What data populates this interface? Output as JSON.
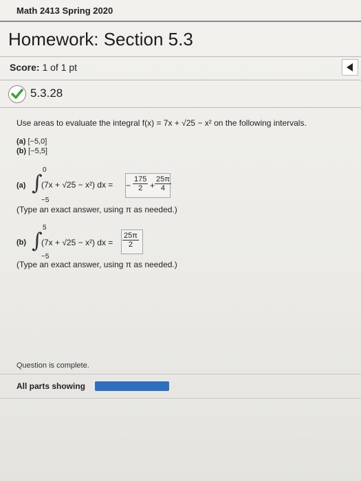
{
  "course_title": "Math 2413 Spring 2020",
  "homework_title": "Homework: Section 5.3",
  "score": {
    "label": "Score:",
    "value": "1 of 1 pt"
  },
  "question_id": "5.3.28",
  "question": {
    "prompt": "Use areas to evaluate the integral f(x) = 7x + √25 − x² on the following intervals.",
    "intervals": [
      {
        "label": "(a)",
        "value": "[−5,0]"
      },
      {
        "label": "(b)",
        "value": "[−5,5]"
      }
    ]
  },
  "parts": [
    {
      "label": "(a)",
      "upper": "0",
      "lower": "−5",
      "integrand": "(7x + √25 − x²) dx =",
      "answer": {
        "sign": "−",
        "num1": "175",
        "den1": "2",
        "op": "+",
        "num2": "25π",
        "den2": "4"
      },
      "note": "(Type an exact answer, using π as needed.)"
    },
    {
      "label": "(b)",
      "upper": "5",
      "lower": "−5",
      "integrand": "(7x + √25 − x²) dx =",
      "answer": {
        "num": "25π",
        "den": "2"
      },
      "note": "(Type an exact answer, using π as needed.)"
    }
  ],
  "status": "Question is complete.",
  "footer": {
    "parts_label": "All parts showing",
    "progress_fraction": 1.0
  },
  "colors": {
    "accent": "#2f6fc0",
    "check": "#3aa33a"
  },
  "icons": {
    "check": "check-circle-icon",
    "collapse": "triangle-left-icon"
  }
}
